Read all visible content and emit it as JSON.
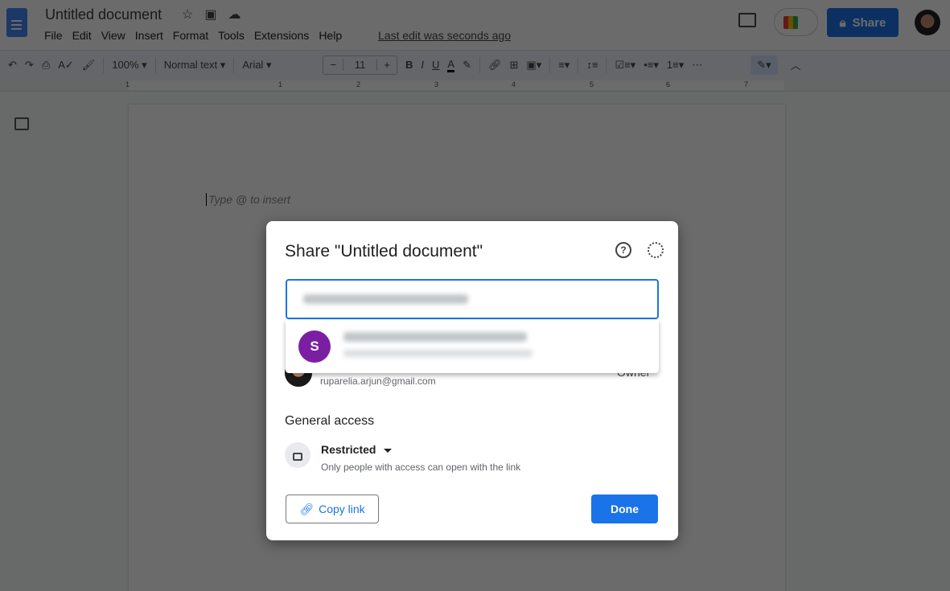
{
  "app": {
    "title": "Untitled document",
    "menu": [
      "File",
      "Edit",
      "View",
      "Insert",
      "Format",
      "Tools",
      "Extensions",
      "Help"
    ],
    "last_edit": "Last edit was seconds ago",
    "share_label": "Share"
  },
  "toolbar": {
    "zoom": "100%",
    "style": "Normal text",
    "font": "Arial",
    "font_size": "11",
    "bold": "B",
    "italic": "I",
    "underline": "U",
    "text_color": "A"
  },
  "ruler": {
    "ticks": [
      "1",
      "1",
      "2",
      "3",
      "4",
      "5",
      "6",
      "7"
    ]
  },
  "doc": {
    "placeholder": "Type @ to insert"
  },
  "dialog": {
    "title": "Share \"Untitled document\"",
    "help_icon": "?",
    "suggestion_initial": "S",
    "owner_email": "ruparelia.arjun@gmail.com",
    "owner_role": "Owner",
    "general_access": "General access",
    "access_level": "Restricted",
    "access_desc": "Only people with access can open with the link",
    "copy_link": "Copy link",
    "done": "Done"
  },
  "colors": {
    "accent": "#1a73e8",
    "suggestion_avatar": "#7b1fa2"
  }
}
